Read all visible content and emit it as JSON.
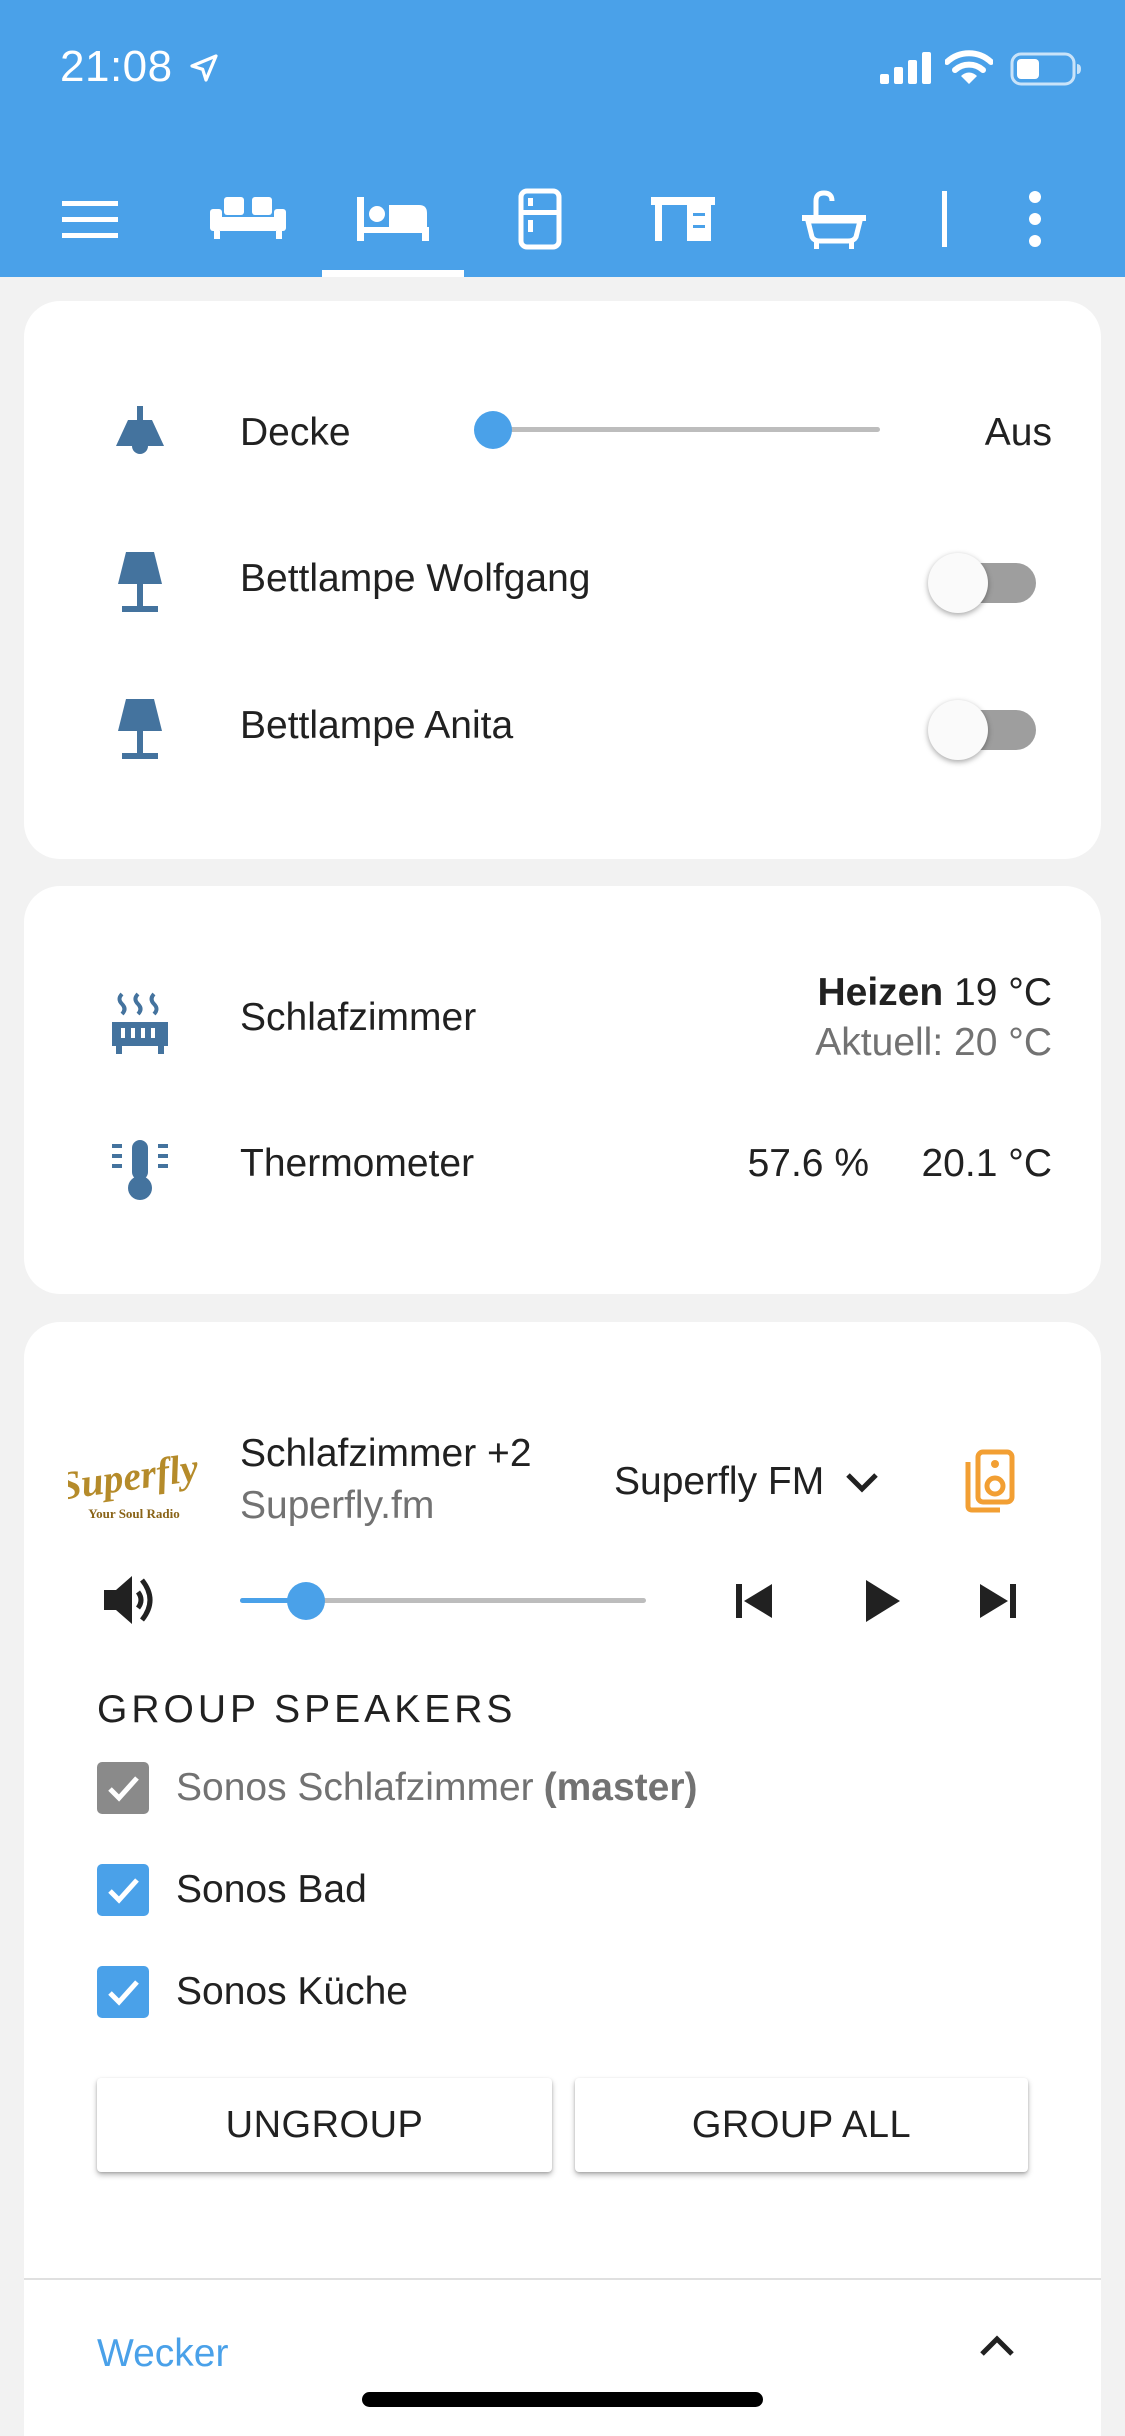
{
  "status": {
    "time": "21:08"
  },
  "tabs": [
    {
      "icon": "sofa-icon"
    },
    {
      "icon": "bed-icon",
      "active": true
    },
    {
      "icon": "fridge-icon"
    },
    {
      "icon": "desk-icon"
    },
    {
      "icon": "bathtub-icon"
    }
  ],
  "lights": {
    "ceiling": {
      "label": "Decke",
      "state": "Aus",
      "brightness": 0
    },
    "lamp1": {
      "label": "Bettlampe Wolfgang",
      "on": false
    },
    "lamp2": {
      "label": "Bettlampe Anita",
      "on": false
    }
  },
  "climate": {
    "thermostat": {
      "label": "Schlafzimmer",
      "mode": "Heizen",
      "target": "19 °C",
      "current": "Aktuell: 20 °C"
    },
    "sensor": {
      "label": "Thermometer",
      "humidity": "57.6 %",
      "temperature": "20.1 °C"
    }
  },
  "media": {
    "logo_text": "Superfly",
    "logo_sub": "Your Soul Radio",
    "room": "Schlafzimmer +2",
    "station": "Superfly.fm",
    "source": "Superfly FM",
    "volume": 0.12,
    "group_title": "GROUP SPEAKERS",
    "speakers": [
      {
        "name": "Sonos Schlafzimmer",
        "suffix": "(master)",
        "checked": true,
        "disabled": true
      },
      {
        "name": "Sonos Bad",
        "suffix": "",
        "checked": true,
        "disabled": false
      },
      {
        "name": "Sonos Küche",
        "suffix": "",
        "checked": true,
        "disabled": false
      }
    ],
    "ungroup_label": "UNGROUP",
    "group_all_label": "GROUP ALL",
    "alarm_label": "Wecker"
  },
  "colors": {
    "accent": "#4aa1e9",
    "icon": "#44739e",
    "orange": "#f29f33"
  }
}
